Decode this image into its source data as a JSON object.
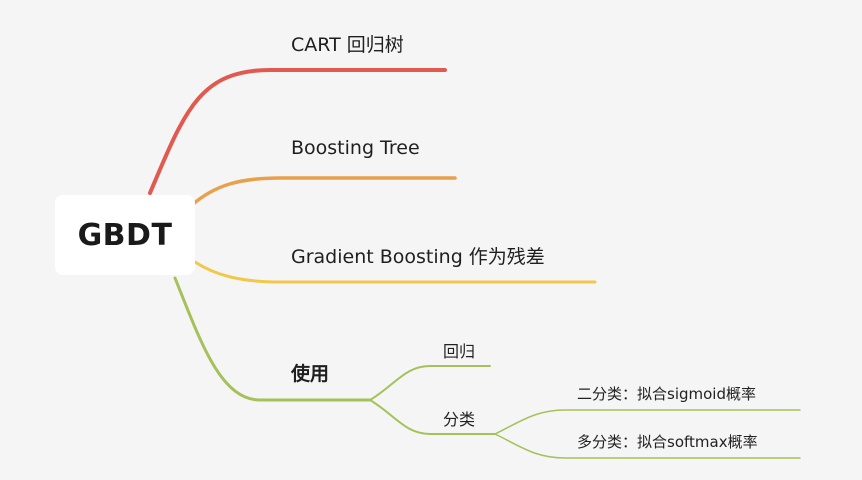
{
  "root": {
    "label": "GBDT"
  },
  "branches": [
    {
      "label": "CART 回归树",
      "color": "#e05a4f"
    },
    {
      "label": "Boosting Tree",
      "color": "#e9a04a"
    },
    {
      "label": "Gradient Boosting 作为残差",
      "color": "#f0c84a"
    },
    {
      "label": "使用",
      "color": "#a5c15a",
      "children": [
        {
          "label": "回归"
        },
        {
          "label": "分类",
          "children": [
            {
              "label": "二分类：拟合sigmoid概率"
            },
            {
              "label": "多分类：拟合softmax概率"
            }
          ]
        }
      ]
    }
  ]
}
